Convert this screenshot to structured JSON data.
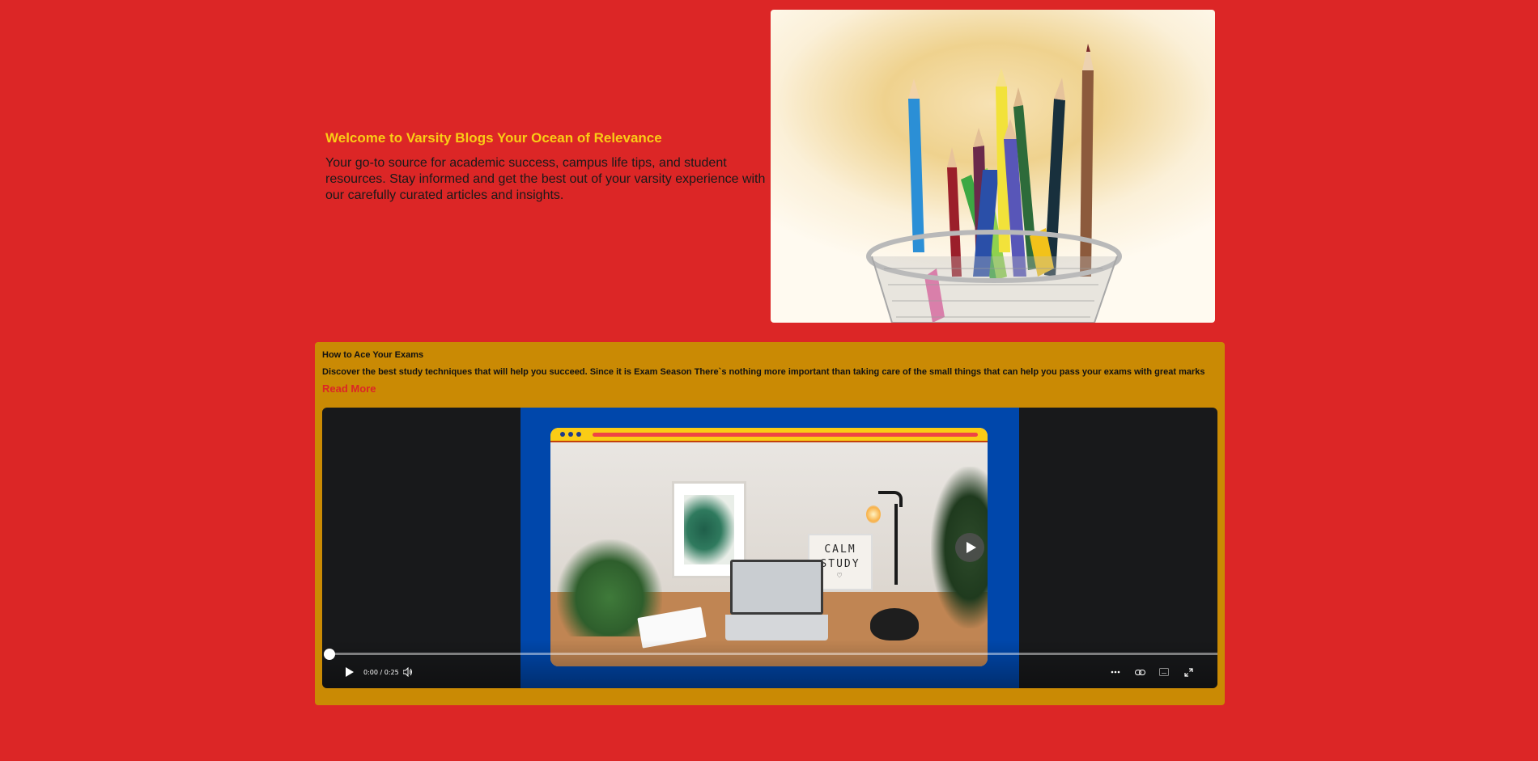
{
  "hero": {
    "title": "Welcome to Varsity Blogs Your Ocean of Relevance",
    "description": "Your go-to source for academic success, campus life tips, and student resources. Stay informed and get the best out of your varsity experience with our carefully curated articles and insights."
  },
  "article": {
    "title": "How to Ace Your Exams",
    "description": "Discover the best study techniques that will help you succeed. Since it is Exam Season There`s nothing more important than taking care of the small things that can help you pass your exams with great marks",
    "read_more_label": "Read More"
  },
  "video": {
    "sign_line1": "CALM",
    "sign_line2": "STUDY",
    "sign_line3": "♡",
    "time_display": "0:00 / 0:25",
    "progress": 0,
    "icons": {
      "play": "play-icon",
      "volume": "volume-icon",
      "more": "more-options-icon",
      "link": "link-icon",
      "captions": "captions-icon",
      "fullscreen": "fullscreen-icon"
    }
  },
  "colors": {
    "page_background": "#dc2626",
    "card_background": "#ca8a04",
    "title_accent": "#facc15",
    "link_accent": "#dc2626",
    "video_background": "#18191b",
    "video_frame": "#0047ab"
  }
}
